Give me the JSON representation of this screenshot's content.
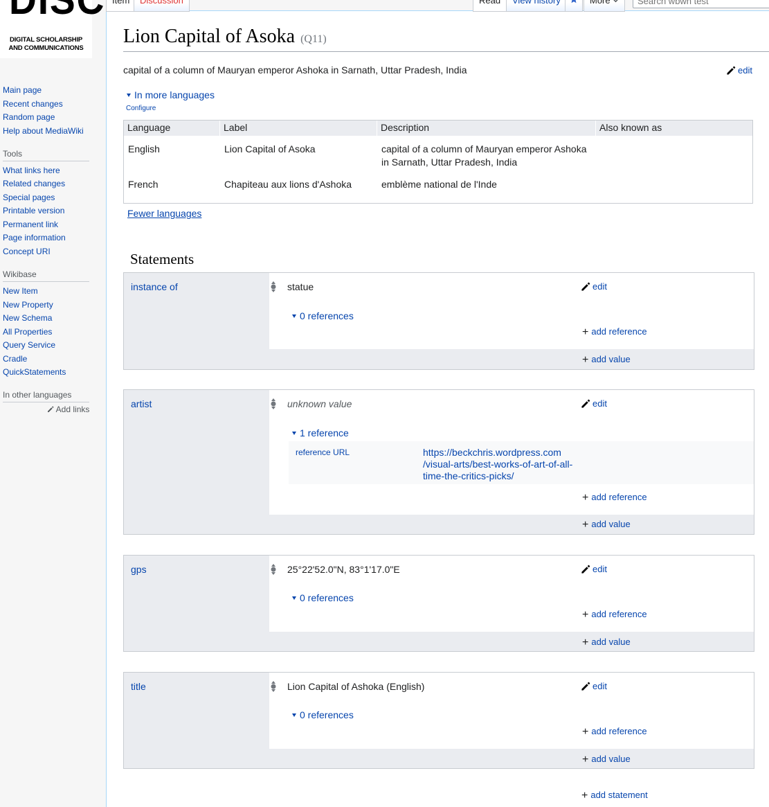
{
  "logo": {
    "big": "DISC",
    "line1": "DIGITAL SCHOLARSHIP",
    "line2": "AND COMMUNICATIONS"
  },
  "sidebar": {
    "nav": [
      "Main page",
      "Recent changes",
      "Random page",
      "Help about MediaWiki"
    ],
    "tools_heading": "Tools",
    "tools": [
      "What links here",
      "Related changes",
      "Special pages",
      "Printable version",
      "Permanent link",
      "Page information",
      "Concept URI"
    ],
    "wikibase_heading": "Wikibase",
    "wikibase": [
      "New Item",
      "New Property",
      "New Schema",
      "All Properties",
      "Query Service",
      "Cradle",
      "QuickStatements"
    ],
    "languages_heading": "In other languages",
    "add_links": "Add links"
  },
  "tabs": {
    "item": "Item",
    "discussion": "Discussion",
    "read": "Read",
    "history": "View history",
    "more": "More",
    "search_placeholder": "Search wbwh test"
  },
  "page": {
    "title": "Lion Capital of Asoka",
    "qid": "(Q11)",
    "description": "capital of a column of Mauryan emperor Ashoka in Sarnath, Uttar Pradesh, India",
    "edit": "edit",
    "in_more_languages": "In more languages",
    "configure": "Configure",
    "fewer_languages": "Fewer languages"
  },
  "languages": {
    "headers": [
      "Language",
      "Label",
      "Description",
      "Also known as"
    ],
    "rows": [
      {
        "language": "English",
        "label": "Lion Capital of Asoka",
        "description_1": "capital of a column of Mauryan emperor Ashoka",
        "description_2": "in Sarnath, Uttar Pradesh, India",
        "also": ""
      },
      {
        "language": "French",
        "label": "Chapiteau aux lions d'Ashoka",
        "description_1": "emblème national de l'Inde",
        "description_2": "",
        "also": ""
      }
    ]
  },
  "statements": {
    "heading": "Statements",
    "edit": "edit",
    "add_reference": "add reference",
    "add_value": "add value",
    "add_statement": "add statement",
    "groups": [
      {
        "property": "instance of",
        "value": "statue",
        "references": "0 references"
      },
      {
        "property": "artist",
        "value": "unknown value",
        "references": "1 reference",
        "ref_property": "reference URL",
        "ref_value_1": "https://beckchris.wordpress.com",
        "ref_value_2": "/visual-arts/best-works-of-art-of-all-",
        "ref_value_3": "time-the-critics-picks/"
      },
      {
        "property": "gps",
        "value": "25°22'52.0\"N, 83°1'17.0\"E",
        "references": "0 references"
      },
      {
        "property": "title",
        "value": "Lion Capital of Ashoka (English)",
        "references": "0 references"
      }
    ]
  }
}
